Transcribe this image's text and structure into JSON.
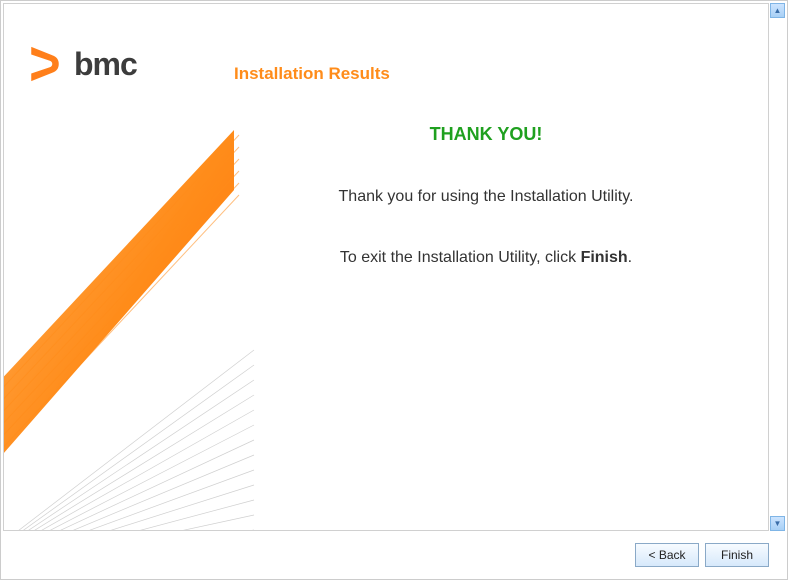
{
  "logo": {
    "brand": "bmc"
  },
  "page": {
    "heading": "Installation Results",
    "thank_you": "THANK YOU!",
    "body1": "Thank you for using the Installation Utility.",
    "exit_prefix": "To exit the Installation Utility, click ",
    "exit_bold": "Finish",
    "exit_suffix": "."
  },
  "buttons": {
    "back": "< Back",
    "finish": "Finish"
  }
}
